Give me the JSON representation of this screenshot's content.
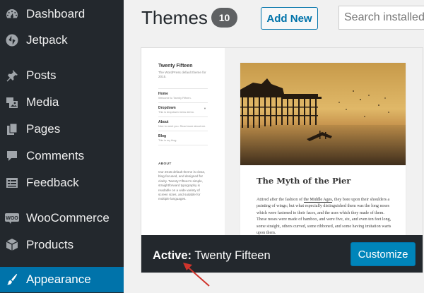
{
  "sidebar": {
    "items": [
      {
        "label": "Dashboard",
        "icon": "dashboard-icon"
      },
      {
        "label": "Jetpack",
        "icon": "jetpack-icon"
      },
      {
        "label": "Posts",
        "icon": "pin-icon"
      },
      {
        "label": "Media",
        "icon": "media-icon"
      },
      {
        "label": "Pages",
        "icon": "pages-icon"
      },
      {
        "label": "Comments",
        "icon": "comments-icon"
      },
      {
        "label": "Feedback",
        "icon": "feedback-icon"
      },
      {
        "label": "WooCommerce",
        "icon": "woocommerce-icon"
      },
      {
        "label": "Products",
        "icon": "products-icon"
      },
      {
        "label": "Appearance",
        "icon": "appearance-icon",
        "active": true
      }
    ],
    "colors": {
      "background": "#23282d",
      "active": "#0073aa"
    }
  },
  "header": {
    "title": "Themes",
    "count": "10",
    "add_new_label": "Add New",
    "search_placeholder": "Search installed themes..."
  },
  "theme": {
    "preview": {
      "site_title": "Twenty Fifteen",
      "tagline": "The WordPress default theme for 2015.",
      "nav": [
        {
          "label": "Home",
          "sub": "Welcome to Twenty Fifteen."
        },
        {
          "label": "Dropdown",
          "sub": "This is dropdown menu demo."
        },
        {
          "label": "About",
          "sub": "Nice to meet you. Read more about me."
        },
        {
          "label": "Blog",
          "sub": "This is my blog."
        }
      ],
      "about_heading": "ABOUT",
      "about_text": "Our 2015 default theme is clean, blog-focused, and designed for clarity. Twenty Fifteen's simple, straightforward typography is readable on a wide variety of screen sizes, and suitable for multiple languages.",
      "post_title": "The Myth of the Pier",
      "post_text_before_link": "Attired after the fashion of ",
      "post_link": "the Middle Ages",
      "post_text_after_link": ", they bore upon their shoulders a painting of wings; but what especially distinguished them was the long noses which were fastened to their faces, and the uses which they made of them. These noses were made of bamboo, and were five, six, and even ten feet long, some straight, others curved, some ribboned, and some having imitation warts upon them."
    },
    "active_prefix": "Active:",
    "active_name": "Twenty Fifteen",
    "customize_label": "Customize"
  },
  "colors": {
    "accent": "#0073aa",
    "button": "#0085ba",
    "arrow": "#d0342c"
  }
}
